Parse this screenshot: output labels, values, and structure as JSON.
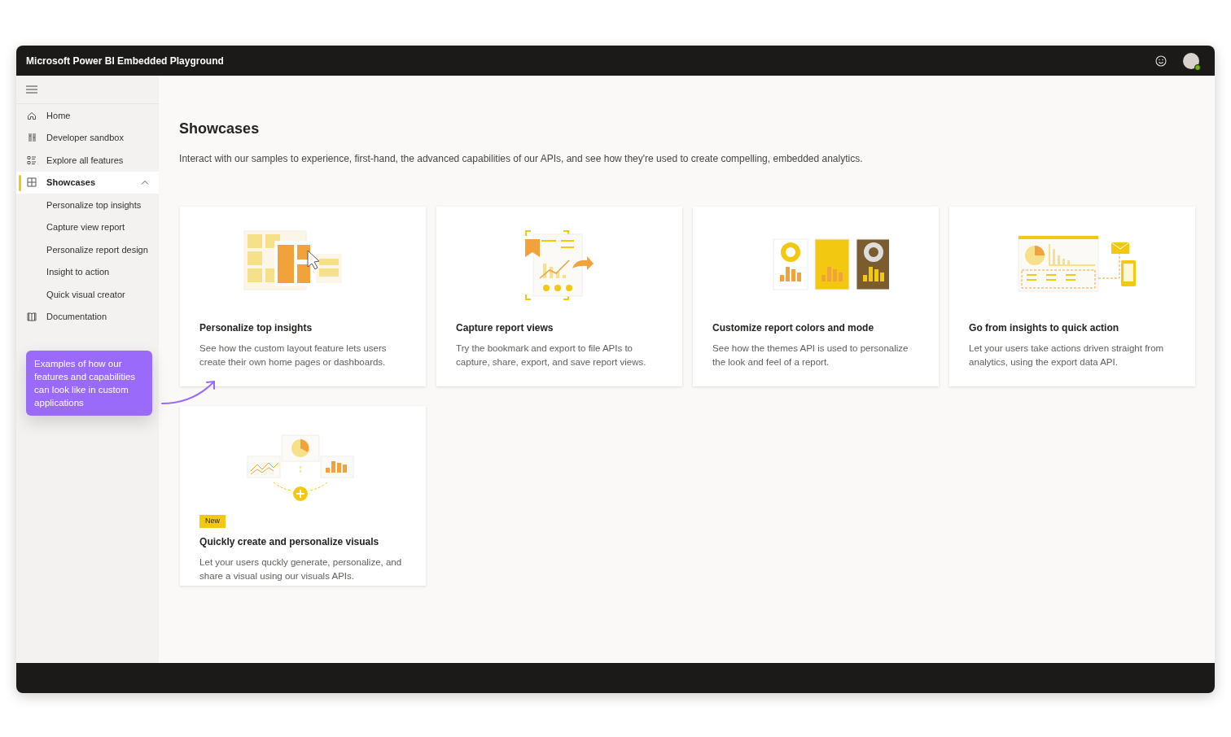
{
  "window": {
    "title": "Microsoft Power BI Embedded Playground"
  },
  "sidebar": {
    "items": [
      {
        "label": "Home",
        "kind": "home",
        "selected": false
      },
      {
        "label": "Developer sandbox",
        "kind": "sandbox",
        "selected": false
      },
      {
        "label": "Explore all features",
        "kind": "features",
        "selected": false
      },
      {
        "label": "Showcases",
        "kind": "showcases",
        "selected": true,
        "expanded": true,
        "children": [
          {
            "label": "Personalize top insights",
            "selected": false
          },
          {
            "label": "Capture view report",
            "selected": false
          },
          {
            "label": "Personalize report design",
            "selected": false
          },
          {
            "label": "Insight to action",
            "selected": false
          },
          {
            "label": "Quick visual creator",
            "selected": false
          }
        ]
      },
      {
        "label": "Documentation",
        "kind": "docs",
        "selected": false
      }
    ]
  },
  "callout": {
    "text": "Examples of how our features and capabilities can look like in custom applications"
  },
  "page": {
    "title": "Showcases",
    "description": "Interact with our samples to experience, first-hand, the advanced capabilities of our APIs, and see how they're used to create compelling, embedded analytics."
  },
  "cards": [
    {
      "kind": "layout",
      "title": "Personalize top insights",
      "description": "See how the custom layout feature lets users create their own home pages or dashboards."
    },
    {
      "kind": "capture",
      "title": "Capture report views",
      "description": "Try the bookmark and export to file APIs to capture, share, export, and save report views."
    },
    {
      "kind": "themes",
      "title": "Customize report colors and mode",
      "description": "See how the themes API is used to personalize the look and feel of a report."
    },
    {
      "kind": "action",
      "title": "Go from insights to quick action",
      "description": "Let your users take actions driven straight from analytics, using the export data API."
    },
    {
      "kind": "visuals",
      "badge": "New",
      "title": "Quickly create and personalize visuals",
      "description": "Let your users quckly generate, personalize, and share a visual using our visuals APIs."
    }
  ]
}
